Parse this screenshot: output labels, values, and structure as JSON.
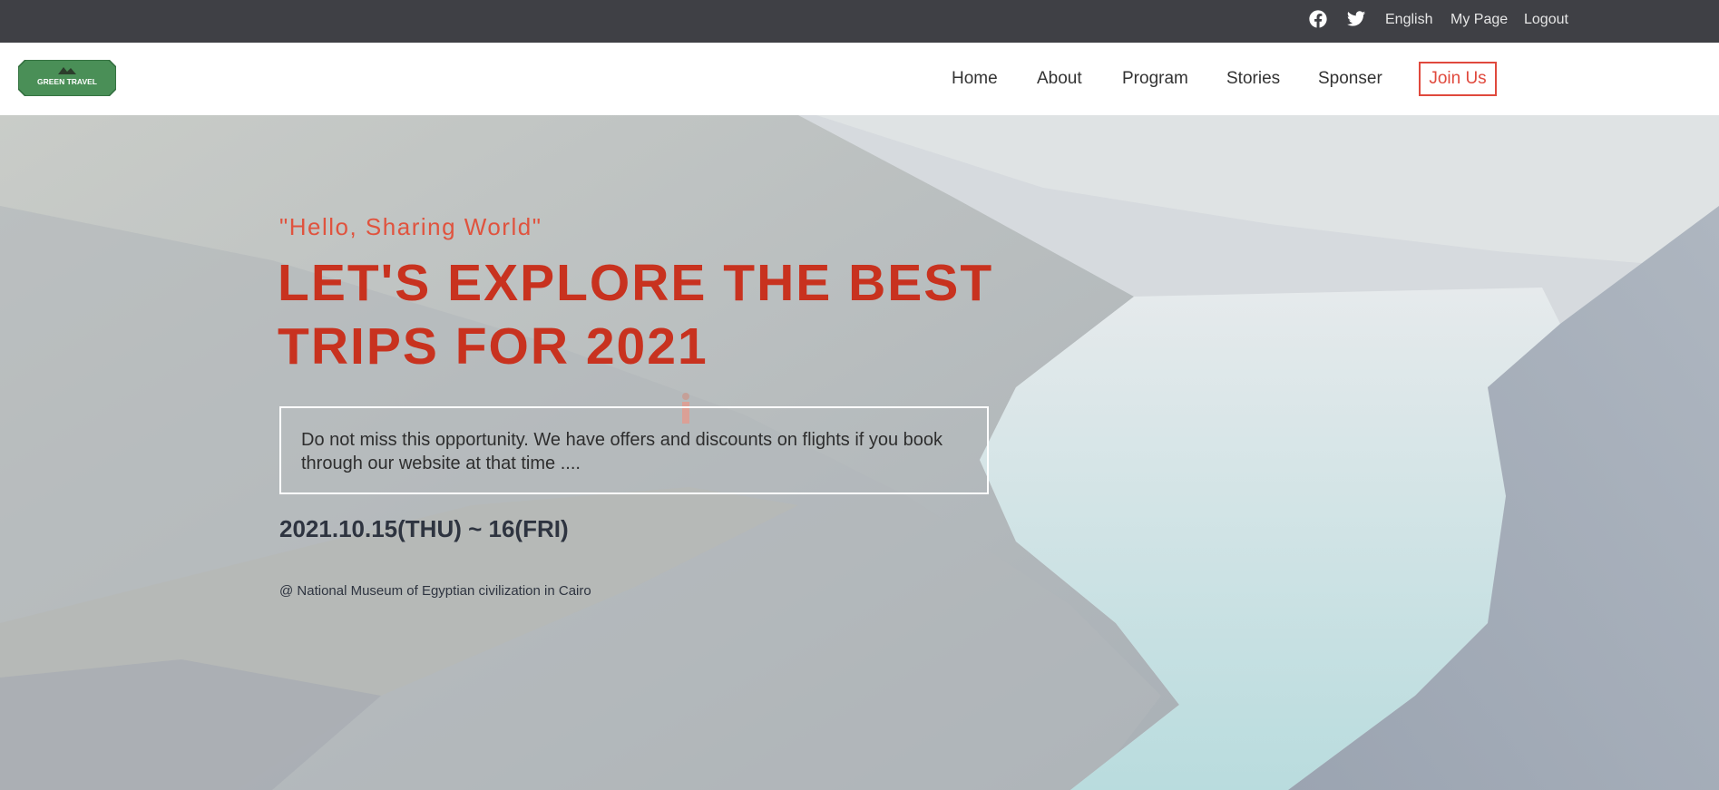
{
  "topbar": {
    "icons": [
      "facebook-icon",
      "twitter-icon"
    ],
    "language": "English",
    "my_page": "My Page",
    "logout": "Logout"
  },
  "header": {
    "logo_text": "GREEN TRAVEL",
    "nav": {
      "home": "Home",
      "about": "About",
      "program": "Program",
      "stories": "Stories",
      "sponser": "Sponser"
    },
    "join": "Join Us"
  },
  "hero": {
    "subtitle": "\"Hello, Sharing World\"",
    "headline_line1": "LET'S EXPLORE THE BEST",
    "headline_line2": "TRIPS FOR 2021",
    "description": "Do not miss this opportunity. We have offers and discounts on flights if you book through our website at that time ....",
    "date": "2021.10.15(THU) ~ 16(FRI)",
    "venue": "@ National Museum of Egyptian civilization in Cairo"
  },
  "colors": {
    "topbar_bg": "#3f4045",
    "accent": "#e0493d",
    "headline": "#c8321f",
    "logo_green": "#4a8f57"
  }
}
